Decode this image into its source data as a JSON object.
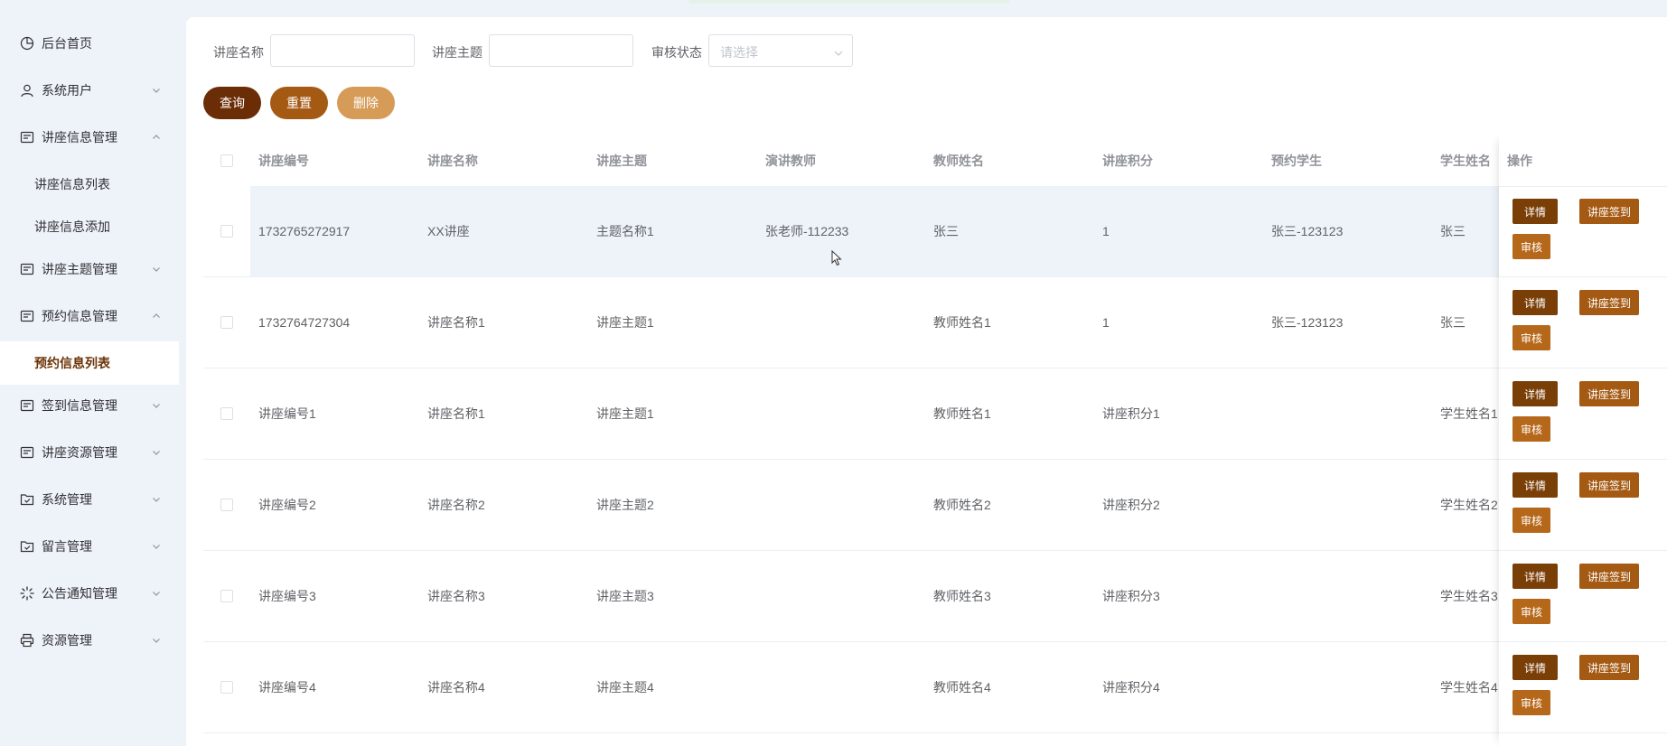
{
  "sidebar": {
    "items": [
      {
        "label": "后台首页",
        "icon": "pie-chart-icon",
        "chevron": "none"
      },
      {
        "label": "系统用户",
        "icon": "user-icon",
        "chevron": "down"
      },
      {
        "label": "讲座信息管理",
        "icon": "document-icon",
        "chevron": "up"
      },
      {
        "label": "讲座信息列表",
        "sub": true
      },
      {
        "label": "讲座信息添加",
        "sub": true
      },
      {
        "label": "讲座主题管理",
        "icon": "document-icon",
        "chevron": "down"
      },
      {
        "label": "预约信息管理",
        "icon": "document-icon",
        "chevron": "up"
      },
      {
        "label": "预约信息列表",
        "sub": true,
        "active": true
      },
      {
        "label": "签到信息管理",
        "icon": "document-icon",
        "chevron": "down"
      },
      {
        "label": "讲座资源管理",
        "icon": "document-icon",
        "chevron": "down"
      },
      {
        "label": "系统管理",
        "icon": "folder-check-icon",
        "chevron": "down"
      },
      {
        "label": "留言管理",
        "icon": "folder-check-icon",
        "chevron": "down"
      },
      {
        "label": "公告通知管理",
        "icon": "loading-icon",
        "chevron": "down"
      },
      {
        "label": "资源管理",
        "icon": "printer-icon",
        "chevron": "down"
      }
    ]
  },
  "filters": {
    "name_label": "讲座名称",
    "theme_label": "讲座主题",
    "status_label": "审核状态",
    "status_placeholder": "请选择"
  },
  "actions": {
    "query": "查询",
    "reset": "重置",
    "delete": "删除"
  },
  "table": {
    "headers": [
      "讲座编号",
      "讲座名称",
      "讲座主题",
      "演讲教师",
      "教师姓名",
      "讲座积分",
      "预约学生",
      "学生姓名"
    ],
    "ops_header": "操作",
    "ops_labels": {
      "detail": "详情",
      "sign": "讲座签到",
      "audit": "审核"
    },
    "rows": [
      [
        "1732765272917",
        "XX讲座",
        "主题名称1",
        "张老师-112233",
        "张三",
        "1",
        "张三-123123",
        "张三"
      ],
      [
        "1732764727304",
        "讲座名称1",
        "讲座主题1",
        "",
        "教师姓名1",
        "1",
        "张三-123123",
        "张三"
      ],
      [
        "讲座编号1",
        "讲座名称1",
        "讲座主题1",
        "",
        "教师姓名1",
        "讲座积分1",
        "",
        "学生姓名1"
      ],
      [
        "讲座编号2",
        "讲座名称2",
        "讲座主题2",
        "",
        "教师姓名2",
        "讲座积分2",
        "",
        "学生姓名2"
      ],
      [
        "讲座编号3",
        "讲座名称3",
        "讲座主题3",
        "",
        "教师姓名3",
        "讲座积分3",
        "",
        "学生姓名3"
      ],
      [
        "讲座编号4",
        "讲座名称4",
        "讲座主题4",
        "",
        "教师姓名4",
        "讲座积分4",
        "",
        "学生姓名4"
      ]
    ]
  },
  "colors": {
    "primary_dark": "#6b2d06",
    "primary": "#a45a13",
    "primary_light": "#d69b57",
    "row_hover": "#eef3fa",
    "sidebar_bg": "#eef2f9"
  }
}
